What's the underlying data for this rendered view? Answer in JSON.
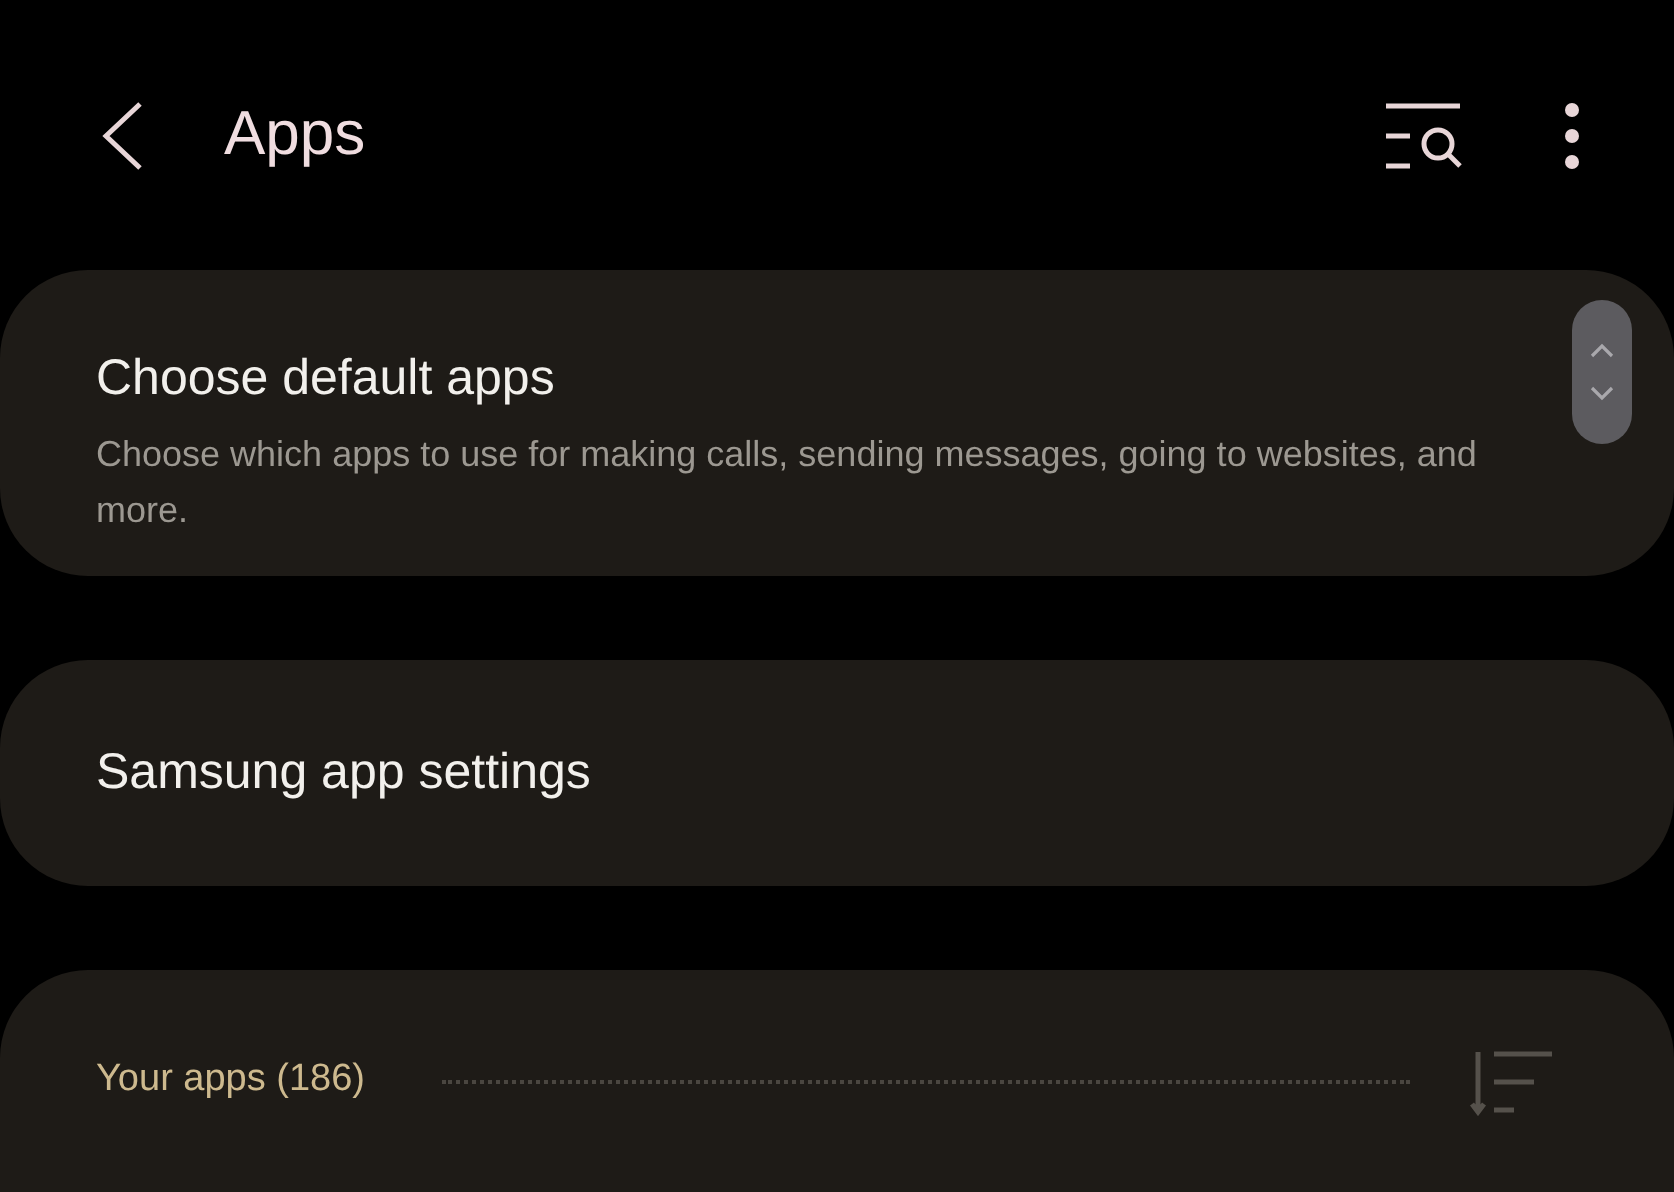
{
  "header": {
    "title": "Apps"
  },
  "items": [
    {
      "title": "Choose default apps",
      "subtitle": "Choose which apps to use for making calls, sending messages, going to websites, and more."
    },
    {
      "title": "Samsung app settings"
    }
  ],
  "section": {
    "title": "Your apps (186)"
  }
}
